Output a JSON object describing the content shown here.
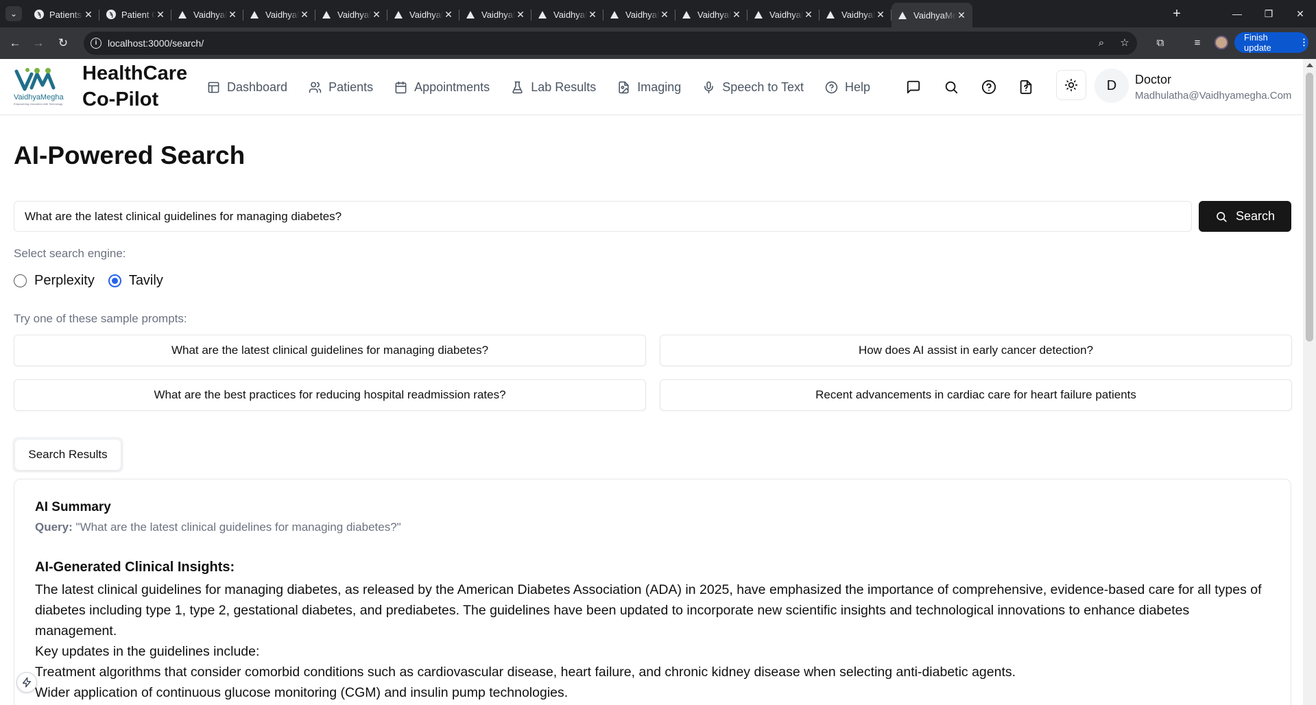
{
  "browser": {
    "tabs": [
      {
        "title": "Patients | M",
        "favicon": "logo"
      },
      {
        "title": "Patient Ch",
        "favicon": "logo"
      },
      {
        "title": "VaidhyaMe",
        "favicon": "triangle"
      },
      {
        "title": "VaidhyaMe",
        "favicon": "triangle"
      },
      {
        "title": "VaidhyaMe",
        "favicon": "triangle"
      },
      {
        "title": "VaidhyaMe",
        "favicon": "triangle"
      },
      {
        "title": "VaidhyaMe",
        "favicon": "triangle"
      },
      {
        "title": "VaidhyaMe",
        "favicon": "triangle"
      },
      {
        "title": "VaidhyaMe",
        "favicon": "triangle"
      },
      {
        "title": "VaidhyaMe",
        "favicon": "triangle"
      },
      {
        "title": "VaidhyaMe",
        "favicon": "triangle"
      },
      {
        "title": "VaidhyaMe",
        "favicon": "triangle"
      },
      {
        "title": "VaidhyaMe",
        "favicon": "triangle",
        "active": true
      }
    ],
    "url": "localhost:3000/search/",
    "finish_update": "Finish update"
  },
  "header": {
    "brand_name": "VaidhyaMegha",
    "brand_tagline": "Empowering Innovation with Technology",
    "title": "HealthCare Co-Pilot",
    "nav": [
      {
        "label": "Dashboard",
        "icon": "layout-icon"
      },
      {
        "label": "Patients",
        "icon": "users-icon"
      },
      {
        "label": "Appointments",
        "icon": "calendar-icon"
      },
      {
        "label": "Lab Results",
        "icon": "flask-icon"
      },
      {
        "label": "Imaging",
        "icon": "image-file-icon"
      },
      {
        "label": "Speech to Text",
        "icon": "mic-icon"
      },
      {
        "label": "Help",
        "icon": "help-circle-icon"
      }
    ],
    "user": {
      "initial": "D",
      "role": "Doctor",
      "email": "Madhulatha@Vaidhyamegha.Com"
    }
  },
  "main": {
    "title": "AI-Powered Search",
    "search": {
      "value": "What are the latest clinical guidelines for managing diabetes?",
      "button_label": "Search"
    },
    "engine_label": "Select search engine:",
    "engines": [
      {
        "label": "Perplexity",
        "checked": false
      },
      {
        "label": "Tavily",
        "checked": true
      }
    ],
    "prompts_label": "Try one of these sample prompts:",
    "prompts": [
      "What are the latest clinical guidelines for managing diabetes?",
      "How does AI assist in early cancer detection?",
      "What are the best practices for reducing hospital readmission rates?",
      "Recent advancements in cardiac care for heart failure patients"
    ],
    "results_tab": "Search Results",
    "results": {
      "summary_title": "AI Summary",
      "query_label": "Query:",
      "query_text": "\"What are the latest clinical guidelines for managing diabetes?\"",
      "insights_title": "AI-Generated Clinical Insights:",
      "paragraphs": [
        "The latest clinical guidelines for managing diabetes, as released by the American Diabetes Association (ADA) in 2025, have emphasized the importance of comprehensive, evidence-based care for all types of diabetes including type 1, type 2, gestational diabetes, and prediabetes. The guidelines have been updated to incorporate new scientific insights and technological innovations to enhance diabetes management.",
        "Key updates in the guidelines include:",
        "Treatment algorithms that consider comorbid conditions such as cardiovascular disease, heart failure, and chronic kidney disease when selecting anti-diabetic agents.",
        "Wider application of continuous glucose monitoring (CGM) and insulin pump technologies."
      ]
    }
  },
  "colors": {
    "accent": "#2563eb",
    "button_dark": "#171717",
    "chrome_bg": "#202124",
    "update_blue": "#0b57d0"
  }
}
